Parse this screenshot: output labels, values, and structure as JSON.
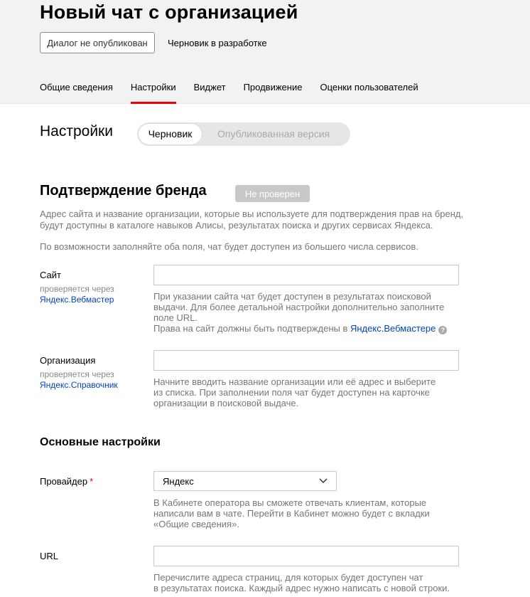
{
  "header": {
    "title": "Новый чат с организацией",
    "publish_status": "Диалог не опубликован",
    "draft_status": "Черновик в разработке",
    "tabs": [
      {
        "label": "Общие сведения"
      },
      {
        "label": "Настройки"
      },
      {
        "label": "Виджет"
      },
      {
        "label": "Продвижение"
      },
      {
        "label": "Оценки пользователей"
      }
    ],
    "active_tab": "Настройки",
    "accent_color": "#ee0000"
  },
  "settings": {
    "title": "Настройки",
    "toggle": {
      "selected": "Черновик",
      "other": "Опубликованная версия"
    }
  },
  "brand": {
    "title": "Подтверждение бренда",
    "badge": "Не проверен",
    "desc1_line1": "Адрес сайта и название организации, которые вы используете для подтверждения прав на бренд,",
    "desc1_line2": "будут доступны в каталоге навыков Алисы, результатах поиска и других сервисах Яндекса.",
    "desc2": "По возможности заполняйте оба поля, чат будет доступен из большего числа сервисов.",
    "site": {
      "label": "Сайт",
      "sub": "проверяется через",
      "link": "Яндекс.Вебмастер",
      "value": "",
      "hint_line1": "При указании сайта чат будет доступен в результатах поисковой",
      "hint_line2": "выдачи. Для более детальной настройки дополнительно заполните",
      "hint_line3": "поле URL.",
      "hint_line4": "Права на сайт должны быть подтверждены в",
      "hint_link": "Яндекс.Вебмастере",
      "help_glyph": "?"
    },
    "organization": {
      "label": "Организация",
      "sub": "проверяется через",
      "link": "Яндекс.Справочник",
      "value": "",
      "hint_line1": "Начните вводить название организации или её адрес и выберите",
      "hint_line2": "из списка. При заполнении поля чат будет доступен на карточке",
      "hint_line3": "организации в поисковой выдаче."
    }
  },
  "main_settings": {
    "title": "Основные настройки",
    "provider": {
      "label": "Провайдер",
      "required_mark": "*",
      "value": "Яндекс",
      "hint_line1": "В Кабинете оператора вы сможете отвечать клиентам, которые",
      "hint_line2": "написали вам в чате. Перейти в Кабинет можно будет с вкладки",
      "hint_line3": "«Общие сведения»."
    },
    "url": {
      "label": "URL",
      "value": "",
      "hint_line1": "Перечислите адреса страниц, для которых будет доступен чат",
      "hint_line2": "в результатах поиска. Каждый адрес нужно написать с новой строки."
    }
  }
}
